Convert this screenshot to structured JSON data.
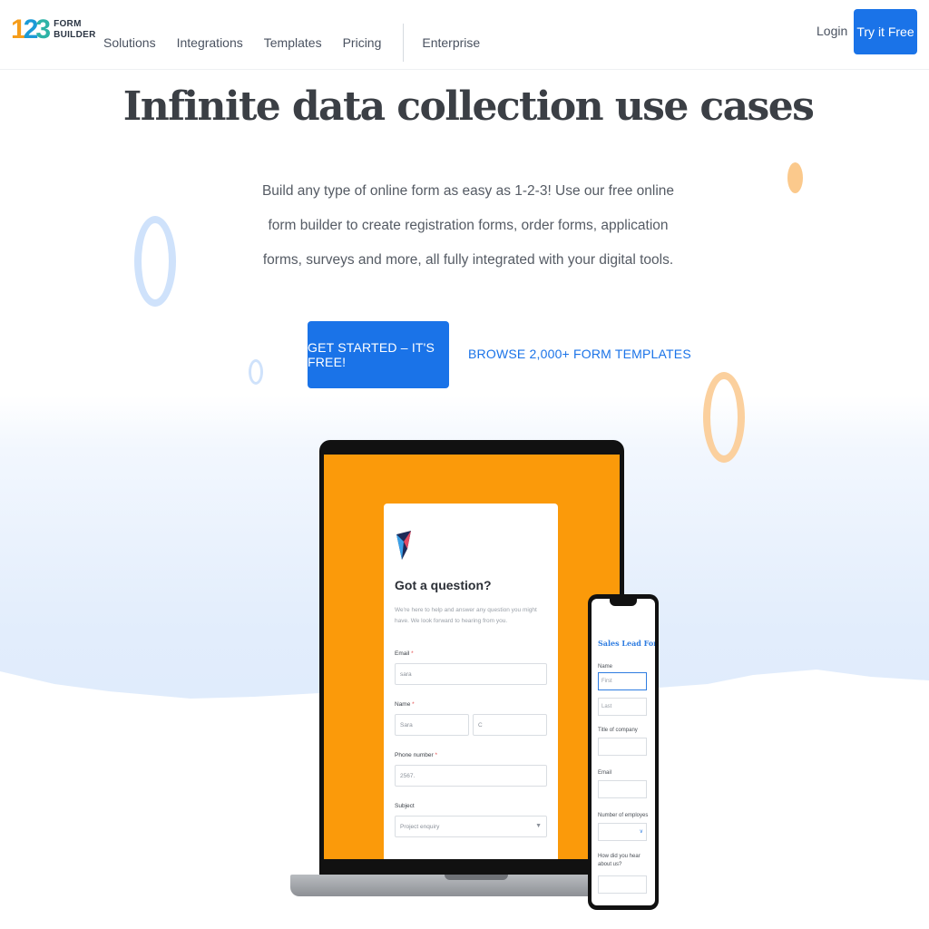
{
  "header": {
    "logo": {
      "number": [
        "1",
        "2",
        "3"
      ],
      "word1": "FORM",
      "word2": "BUILDER"
    },
    "nav": [
      {
        "label": "Solutions"
      },
      {
        "label": "Integrations"
      },
      {
        "label": "Templates"
      },
      {
        "label": "Pricing"
      },
      {
        "label": "Enterprise"
      }
    ],
    "login_label": "Login",
    "try_label": "Try it Free"
  },
  "hero": {
    "title": "Infinite data collection use cases",
    "description": "Build any type of online form as easy as 1-2-3! Use our free online form builder to create registration forms, order forms, application forms, surveys and more, all fully integrated with your digital tools.",
    "cta_label": "GET STARTED – IT'S FREE!",
    "browse_label": "BROWSE 2,000+ FORM TEMPLATES"
  },
  "laptop_form": {
    "title": "Got a question?",
    "description": "We're here to help and answer any question you might have. We look forward to hearing from you.",
    "email_label": "Email",
    "email_value": "sara",
    "name_label": "Name",
    "first_name_value": "Sara",
    "last_name_value": "C",
    "phone_label": "Phone number",
    "phone_value": "2567.",
    "subject_label": "Subject",
    "subject_value": "Project enquiry",
    "required_mark": "*"
  },
  "phone_form": {
    "title": "Sales Lead Form",
    "name_label": "Name",
    "first_placeholder": "First",
    "last_placeholder": "Last",
    "company_label": "Title of company",
    "email_label": "Email",
    "employees_label": "Number of employes",
    "hear_label": "How did you hear about us?"
  },
  "colors": {
    "brand_blue": "#1a73e8",
    "laptop_screen_orange": "#fb9a0a",
    "ring_blue": "#cfe2fb",
    "ring_orange": "#fbd09e"
  },
  "icons": [
    "form-logo-icon",
    "chevron-down-icon"
  ]
}
